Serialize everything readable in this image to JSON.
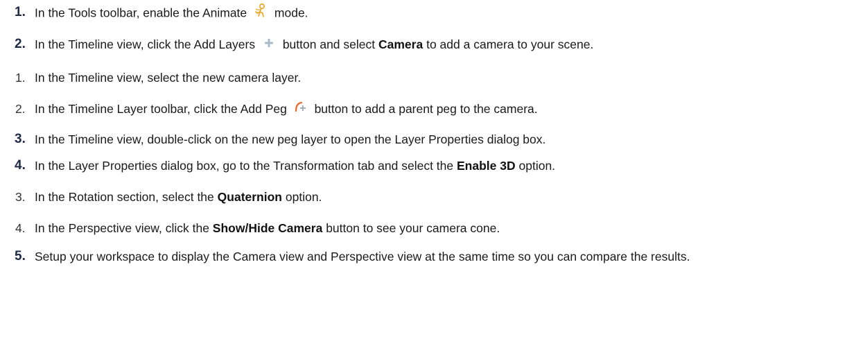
{
  "steps": [
    {
      "number": "1.",
      "number_style": "bold",
      "before": "In the Tools toolbar, enable the Animate",
      "icon": "animate-icon",
      "after": "mode."
    },
    {
      "number": "2.",
      "number_style": "bold",
      "before": "In the Timeline view, click the Add Layers",
      "icon": "add-layers-icon",
      "middle": "button and select",
      "bold": "Camera",
      "after": "to add a camera to your scene."
    },
    {
      "number": "1.",
      "number_style": "plain",
      "before": "In the Timeline view, select the new camera layer."
    },
    {
      "number": "2.",
      "number_style": "plain",
      "before": "In the Timeline Layer toolbar, click the Add Peg",
      "icon": "add-peg-icon",
      "after": "button to add a parent peg to the camera."
    },
    {
      "number": "3.",
      "number_style": "bold",
      "before": "In the Timeline view, double-click on the new peg layer to open the Layer Properties dialog box."
    },
    {
      "number": "4.",
      "number_style": "bold",
      "before": "In the Layer Properties dialog box, go to the Transformation tab and select the",
      "bold": "Enable 3D",
      "after": "option."
    },
    {
      "number": "3.",
      "number_style": "plain",
      "before": "In the Rotation section, select the",
      "bold": "Quaternion",
      "after": "option."
    },
    {
      "number": "4.",
      "number_style": "plain",
      "before": "In the Perspective view, click the",
      "bold": "Show/Hide Camera",
      "after": "button to see your camera cone."
    },
    {
      "number": "5.",
      "number_style": "bold",
      "before": "Setup your workspace to display the Camera view and Perspective view at the same time so you can compare the results."
    }
  ],
  "colors": {
    "animate_icon": "#e8a020",
    "add_layers_icon": "#a8bcc8",
    "add_peg_icon_orange": "#e8692a",
    "add_peg_icon_grey": "#9aa8b2"
  }
}
